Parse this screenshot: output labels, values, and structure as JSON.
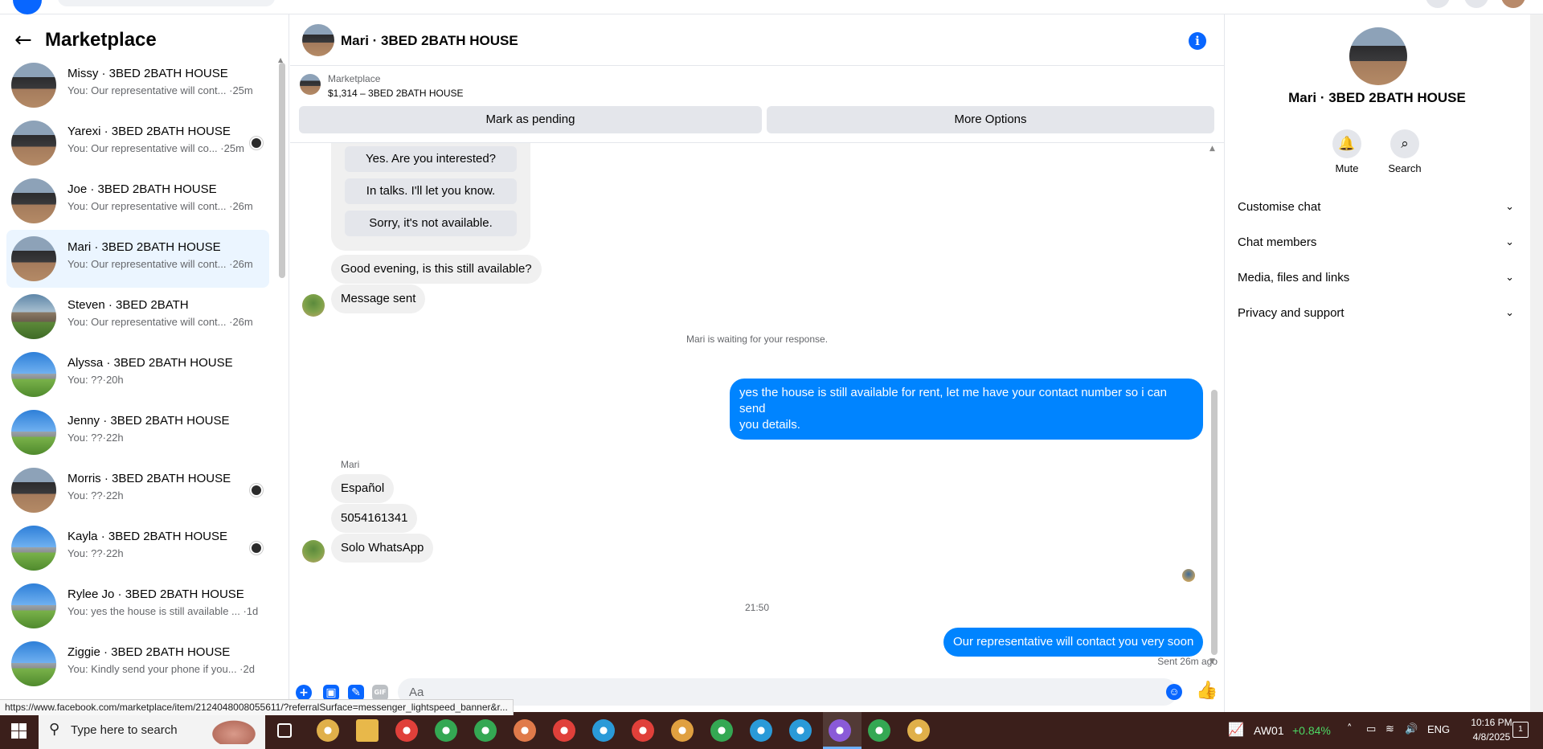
{
  "sidebar": {
    "title": "Marketplace",
    "conversations": [
      {
        "name": "Missy · 3BED 2BATH HOUSE",
        "preview": "You: Our representative will cont... ·25m",
        "avatar": "dark",
        "badge": false
      },
      {
        "name": "Yarexi · 3BED 2BATH HOUSE",
        "preview": "You: Our representative will co... ·25m",
        "avatar": "dark",
        "badge": true
      },
      {
        "name": "Joe · 3BED 2BATH HOUSE",
        "preview": "You: Our representative will cont... ·26m",
        "avatar": "dark",
        "badge": false
      },
      {
        "name": "Mari · 3BED 2BATH HOUSE",
        "preview": "You: Our representative will cont... ·26m",
        "avatar": "dark",
        "badge": false,
        "active": true
      },
      {
        "name": "Steven · 3BED 2BATH",
        "preview": "You: Our representative will cont... ·26m",
        "avatar": "house",
        "badge": false
      },
      {
        "name": "Alyssa · 3BED 2BATH HOUSE",
        "preview": "You: ??·20h",
        "avatar": "sky",
        "badge": false
      },
      {
        "name": "Jenny · 3BED 2BATH HOUSE",
        "preview": "You: ??·22h",
        "avatar": "sky",
        "badge": false
      },
      {
        "name": "Morris · 3BED 2BATH HOUSE",
        "preview": "You: ??·22h",
        "avatar": "dark",
        "badge": true
      },
      {
        "name": "Kayla · 3BED 2BATH HOUSE",
        "preview": "You: ??·22h",
        "avatar": "sky",
        "badge": true
      },
      {
        "name": "Rylee Jo · 3BED 2BATH HOUSE",
        "preview": "You: yes the house is still available ... ·1d",
        "avatar": "sky",
        "badge": false
      },
      {
        "name": "Ziggie · 3BED 2BATH HOUSE",
        "preview": "You: Kindly send your phone if you... ·2d",
        "avatar": "sky",
        "badge": false
      }
    ]
  },
  "chat": {
    "title": "Mari · 3BED 2BATH HOUSE",
    "marketplace_label": "Marketplace",
    "listing": "$1,314 – 3BED 2BATH HOUSE",
    "mark_pending_label": "Mark as pending",
    "more_options_label": "More Options",
    "quick_replies": [
      "Yes. Are you interested?",
      "In talks. I'll let you know.",
      "Sorry, it's not available."
    ],
    "incoming_1": "Good evening, is this still available?",
    "incoming_2": "Message sent",
    "waiting_notice": "Mari is waiting for your response.",
    "outgoing_1_line1": "yes the house is still available for rent, let me have your contact number so i can send",
    "outgoing_1_line2": "you details.",
    "sender_name": "Mari",
    "incoming_3": "Español",
    "incoming_4": "5054161341",
    "incoming_5": "Solo WhatsApp",
    "time_divider": "21:50",
    "outgoing_2": "Our representative will contact you very soon",
    "sent_status": "Sent 26m ago",
    "composer_placeholder": "Aa"
  },
  "status_url": "https://www.facebook.com/marketplace/item/2124048008055611/?referralSurface=messenger_lightspeed_banner&r...",
  "right_panel": {
    "title": "Mari · 3BED 2BATH HOUSE",
    "mute_label": "Mute",
    "search_label": "Search",
    "rows": [
      "Customise chat",
      "Chat members",
      "Media, files and links",
      "Privacy and support"
    ]
  },
  "taskbar": {
    "search_placeholder": "Type here to search",
    "stock_name": "AW01",
    "stock_change": "+0.84%",
    "language": "ENG",
    "time": "10:16 PM",
    "date": "4/8/2025",
    "notification_count": "1"
  },
  "icons": {
    "back": "arrow-left-icon",
    "info": "info-icon",
    "mute": "bell-icon",
    "search": "search-icon",
    "chevron": "chevron-down-icon",
    "like": "thumbs-up-icon",
    "emoji": "emoji-icon"
  },
  "colors": {
    "accent": "#0866ff",
    "outgoing_bubble": "#0084ff",
    "incoming_bubble": "#f0f0f0",
    "active_conversation": "#ebf5ff",
    "taskbar": "#3b1f1b"
  }
}
